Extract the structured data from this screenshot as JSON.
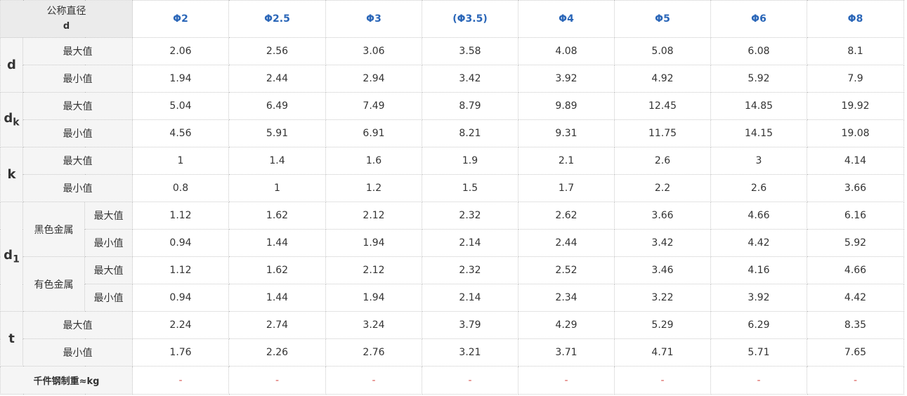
{
  "header": {
    "label_top": "公称直径",
    "label_sym": "d",
    "columns": [
      "Φ2",
      "Φ2.5",
      "Φ3",
      "(Φ3.5)",
      "Φ4",
      "Φ5",
      "Φ6",
      "Φ8"
    ]
  },
  "labels": {
    "max": "最大值",
    "min": "最小值"
  },
  "groups": {
    "d": {
      "name": "d",
      "max": [
        "2.06",
        "2.56",
        "3.06",
        "3.58",
        "4.08",
        "5.08",
        "6.08",
        "8.1"
      ],
      "min": [
        "1.94",
        "2.44",
        "2.94",
        "3.42",
        "3.92",
        "4.92",
        "5.92",
        "7.9"
      ]
    },
    "dk": {
      "name": "d",
      "sub": "k",
      "max": [
        "5.04",
        "6.49",
        "7.49",
        "8.79",
        "9.89",
        "12.45",
        "14.85",
        "19.92"
      ],
      "min": [
        "4.56",
        "5.91",
        "6.91",
        "8.21",
        "9.31",
        "11.75",
        "14.15",
        "19.08"
      ]
    },
    "k": {
      "name": "k",
      "max": [
        "1",
        "1.4",
        "1.6",
        "1.9",
        "2.1",
        "2.6",
        "3",
        "4.14"
      ],
      "min": [
        "0.8",
        "1",
        "1.2",
        "1.5",
        "1.7",
        "2.2",
        "2.6",
        "3.66"
      ]
    },
    "d1": {
      "name": "d",
      "sub": "1",
      "ferrous": {
        "label": "黑色金属",
        "max": [
          "1.12",
          "1.62",
          "2.12",
          "2.32",
          "2.62",
          "3.66",
          "4.66",
          "6.16"
        ],
        "min": [
          "0.94",
          "1.44",
          "1.94",
          "2.14",
          "2.44",
          "3.42",
          "4.42",
          "5.92"
        ]
      },
      "nonferrous": {
        "label": "有色金属",
        "max": [
          "1.12",
          "1.62",
          "2.12",
          "2.32",
          "2.52",
          "3.46",
          "4.16",
          "4.66"
        ],
        "min": [
          "0.94",
          "1.44",
          "1.94",
          "2.14",
          "2.34",
          "3.22",
          "3.92",
          "4.42"
        ]
      }
    },
    "t": {
      "name": "t",
      "max": [
        "2.24",
        "2.74",
        "3.24",
        "3.79",
        "4.29",
        "5.29",
        "6.29",
        "8.35"
      ],
      "min": [
        "1.76",
        "2.26",
        "2.76",
        "3.21",
        "3.71",
        "4.71",
        "5.71",
        "7.65"
      ]
    }
  },
  "weight": {
    "label": "千件钢制重≈kg",
    "values": [
      "-",
      "-",
      "-",
      "-",
      "-",
      "-",
      "-",
      "-"
    ]
  }
}
